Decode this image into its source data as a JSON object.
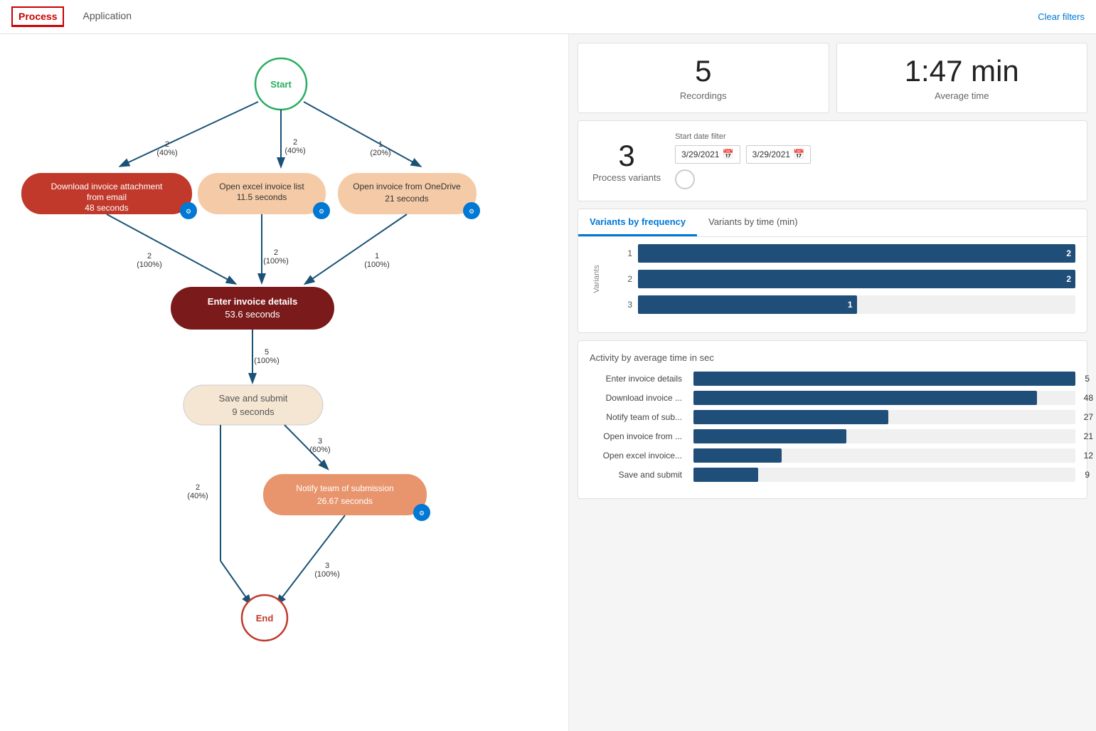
{
  "nav": {
    "tabs": [
      {
        "id": "process",
        "label": "Process",
        "active": true
      },
      {
        "id": "application",
        "label": "Application",
        "active": false
      }
    ],
    "clear_filters": "Clear filters"
  },
  "stats": {
    "recordings": {
      "value": "5",
      "label": "Recordings"
    },
    "avg_time": {
      "value": "1:47 min",
      "label": "Average time"
    },
    "process_variants": {
      "value": "3",
      "label": "Process variants"
    },
    "date_filter_label": "Start date filter",
    "date_from": "3/29/2021",
    "date_to": "3/29/2021"
  },
  "variants_chart": {
    "tab1": "Variants by frequency",
    "tab2": "Variants by time (min)",
    "y_axis_label": "Variants",
    "bars": [
      {
        "label": "1",
        "value": 2,
        "max": 2
      },
      {
        "label": "2",
        "value": 2,
        "max": 2
      },
      {
        "label": "3",
        "value": 1,
        "max": 2
      }
    ]
  },
  "activity_chart": {
    "title": "Activity by average time in sec",
    "bars": [
      {
        "label": "Enter invoice details",
        "value": 53,
        "display": "5",
        "pct": 100
      },
      {
        "label": "Download invoice ...",
        "value": 48,
        "display": "48",
        "pct": 90
      },
      {
        "label": "Notify team of sub...",
        "value": 27,
        "display": "27",
        "pct": 50
      },
      {
        "label": "Open invoice from ...",
        "value": 21,
        "display": "21",
        "pct": 39
      },
      {
        "label": "Open excel invoice...",
        "value": 12,
        "display": "12",
        "pct": 22
      },
      {
        "label": "Save and submit",
        "value": 9,
        "display": "9",
        "pct": 16
      }
    ]
  },
  "flow": {
    "start_label": "Start",
    "end_label": "End",
    "nodes": [
      {
        "id": "download",
        "label": "Download invoice attachment from email\n48 seconds",
        "color": "#c0392b",
        "text_color": "#fff"
      },
      {
        "id": "excel",
        "label": "Open excel invoice list\n11.5 seconds",
        "color": "#f5cba7",
        "text_color": "#333"
      },
      {
        "id": "onedrive",
        "label": "Open invoice from OneDrive\n21 seconds",
        "color": "#f5cba7",
        "text_color": "#333"
      },
      {
        "id": "enter",
        "label": "Enter invoice details\n53.6 seconds",
        "color": "#7b1a1a",
        "text_color": "#fff"
      },
      {
        "id": "save",
        "label": "Save and submit\n9 seconds",
        "color": "#f5e6d3",
        "text_color": "#333"
      },
      {
        "id": "notify",
        "label": "Notify team of submission\n26.67 seconds",
        "color": "#e8956d",
        "text_color": "#fff"
      }
    ],
    "edges": [
      {
        "from": "start",
        "to": "download",
        "label": "2\n(40%)"
      },
      {
        "from": "start",
        "to": "excel",
        "label": "2\n(40%)"
      },
      {
        "from": "start",
        "to": "onedrive",
        "label": "1\n(20%)"
      },
      {
        "from": "download",
        "to": "enter",
        "label": "2\n(100%)"
      },
      {
        "from": "excel",
        "to": "enter",
        "label": "2\n(100%)"
      },
      {
        "from": "onedrive",
        "to": "enter",
        "label": "1\n(100%)"
      },
      {
        "from": "enter",
        "to": "save",
        "label": "5\n(100%)"
      },
      {
        "from": "save",
        "to": "notify",
        "label": "3\n(60%)"
      },
      {
        "from": "save",
        "to": "end",
        "label": "2\n(40%)"
      },
      {
        "from": "notify",
        "to": "end",
        "label": "3\n(100%)"
      }
    ]
  }
}
